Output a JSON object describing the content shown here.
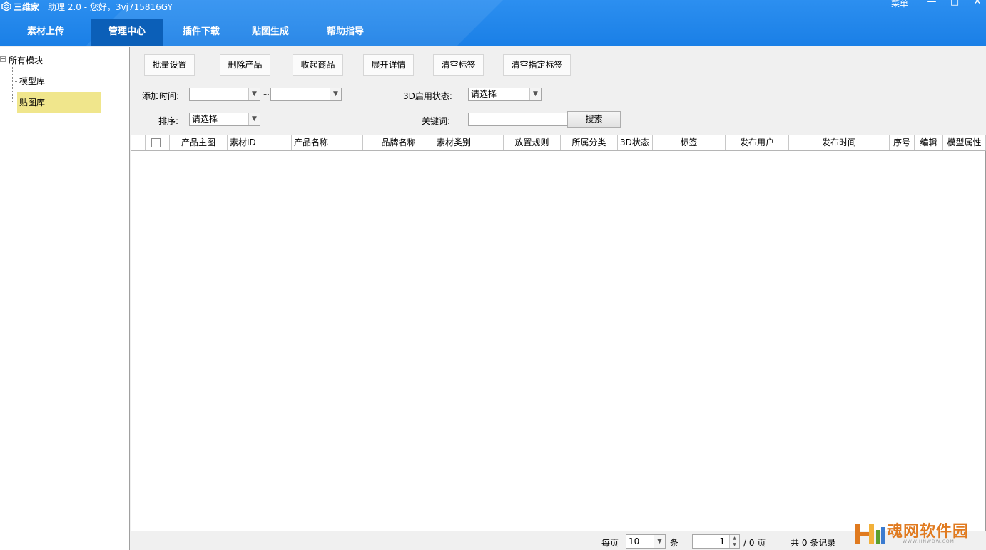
{
  "window": {
    "app_name": "三维家",
    "title": "助理 2.0 - 您好，3vj715816GY",
    "menu_label": "菜单",
    "minimize_glyph": "—",
    "maximize_glyph": "□",
    "close_glyph": "✕"
  },
  "nav": {
    "tabs": [
      {
        "label": "素材上传"
      },
      {
        "label": "管理中心"
      },
      {
        "label": "插件下载"
      },
      {
        "label": "贴图生成"
      },
      {
        "label": "帮助指导"
      }
    ],
    "active_index": 1
  },
  "tree": {
    "root": "所有模块",
    "expander": "−",
    "items": [
      {
        "label": "模型库"
      },
      {
        "label": "贴图库"
      }
    ],
    "selected_index": 1
  },
  "toolbar": {
    "buttons": [
      {
        "label": "批量设置"
      },
      {
        "label": "删除产品"
      },
      {
        "label": "收起商品"
      },
      {
        "label": "展开详情"
      },
      {
        "label": "清空标签"
      },
      {
        "label": "清空指定标签"
      }
    ]
  },
  "filters": {
    "add_time_label": "添加时间:",
    "range_sep": "~",
    "date_from": "",
    "date_to": "",
    "status_label": "3D启用状态:",
    "status_value": "请选择",
    "sort_label": "排序:",
    "sort_value": "请选择",
    "keyword_label": "关键词:",
    "keyword_value": "",
    "search_label": "搜索"
  },
  "grid": {
    "columns": [
      {
        "label": "产品主图"
      },
      {
        "label": "素材ID"
      },
      {
        "label": "产品名称"
      },
      {
        "label": "品牌名称"
      },
      {
        "label": "素材类别"
      },
      {
        "label": "放置规则"
      },
      {
        "label": "所属分类"
      },
      {
        "label": "3D状态"
      },
      {
        "label": "标签"
      },
      {
        "label": "发布用户"
      },
      {
        "label": "发布时间"
      },
      {
        "label": "序号"
      },
      {
        "label": "编辑"
      },
      {
        "label": "模型属性"
      }
    ],
    "rows": []
  },
  "pager": {
    "per_page_label": "每页",
    "per_page_value": "10",
    "unit_label": "条",
    "page_value": "1",
    "total_pages_label": "/ 0 页",
    "total_records_label": "共 0 条记录"
  },
  "watermark": {
    "text": "魂网软件园",
    "sub": "WWW.HNWDW.COM"
  },
  "colors": {
    "nav_bg": "#1a7fe6",
    "nav_active": "#0b5fb8",
    "tree_selected": "#f0e68c",
    "watermark": "#e07a1f"
  }
}
